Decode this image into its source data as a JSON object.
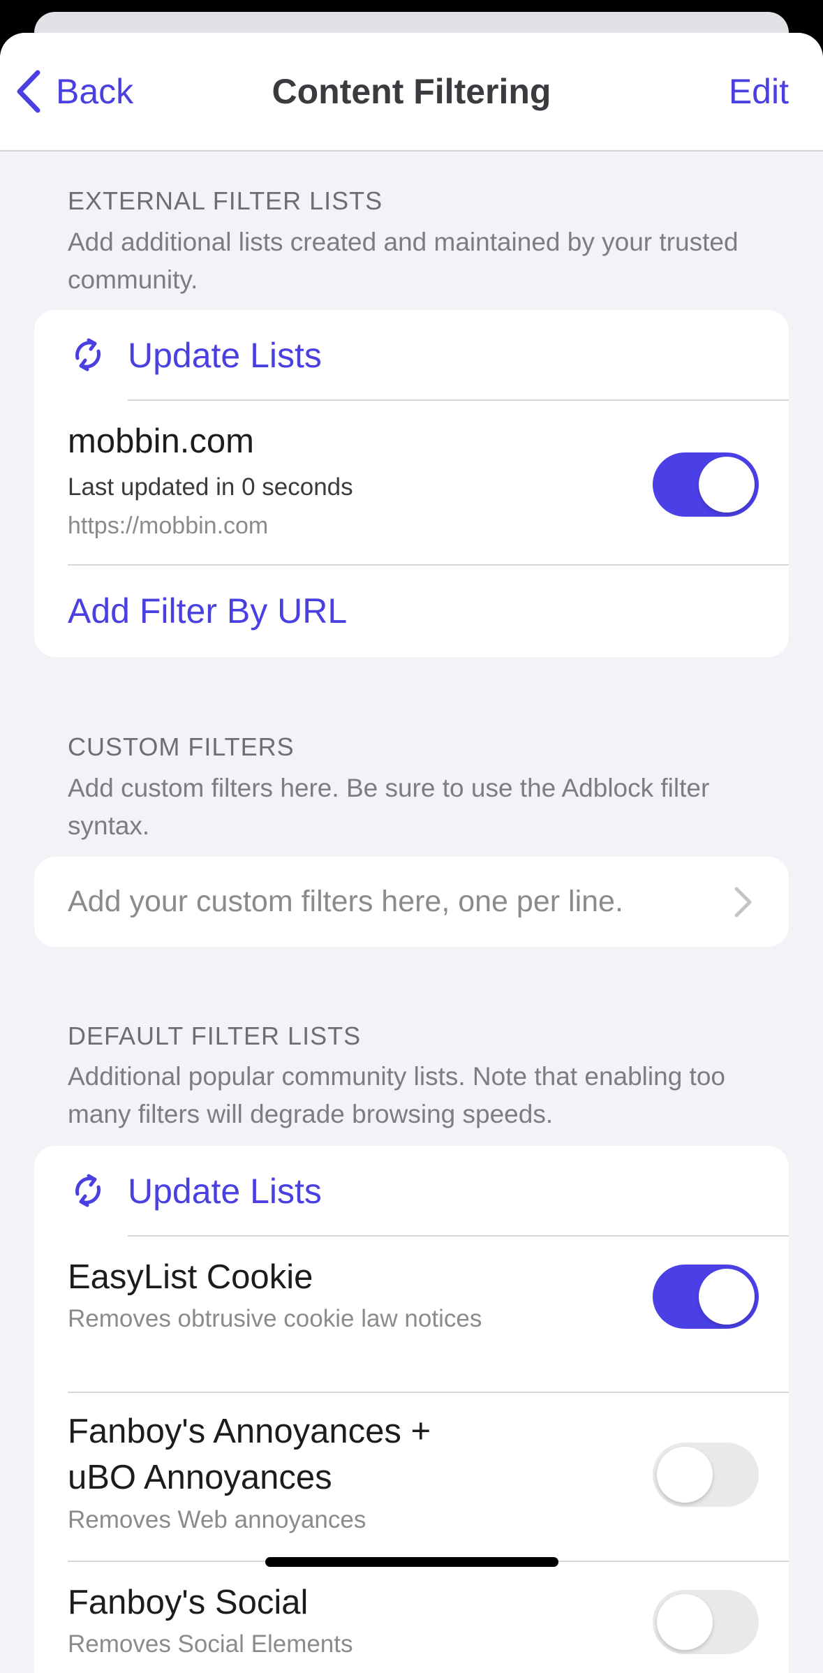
{
  "nav": {
    "back_label": "Back",
    "title": "Content Filtering",
    "edit_label": "Edit"
  },
  "external": {
    "header": "EXTERNAL FILTER LISTS",
    "description": "Add additional lists created and maintained by your trusted community.",
    "update_label": "Update Lists",
    "items": [
      {
        "title": "mobbin.com",
        "status": "Last updated in 0 seconds",
        "url": "https://mobbin.com",
        "enabled": true
      }
    ],
    "add_label": "Add Filter By URL"
  },
  "custom": {
    "header": "CUSTOM FILTERS",
    "description": "Add custom filters here. Be sure to use the Adblock filter syntax.",
    "placeholder": "Add your custom filters here, one per line."
  },
  "defaults": {
    "header": "DEFAULT FILTER LISTS",
    "description": "Additional popular community lists. Note that enabling too many filters will degrade browsing speeds.",
    "update_label": "Update Lists",
    "items": [
      {
        "title": "EasyList Cookie",
        "description": "Removes obtrusive cookie law notices",
        "enabled": true
      },
      {
        "title_line1": "Fanboy's Annoyances +",
        "title_line2": "uBO Annoyances",
        "description": "Removes Web annoyances",
        "enabled": false
      },
      {
        "title": "Fanboy's Social",
        "description": "Removes Social Elements",
        "enabled": false
      }
    ]
  },
  "colors": {
    "accent": "#4a3fe0",
    "toggle_on": "#4a40e6",
    "toggle_off": "#e9e9ea",
    "background": "#f2f2f7"
  },
  "icons": {
    "back": "chevron-left-icon",
    "update": "refresh-icon",
    "disclosure": "chevron-right-icon"
  }
}
